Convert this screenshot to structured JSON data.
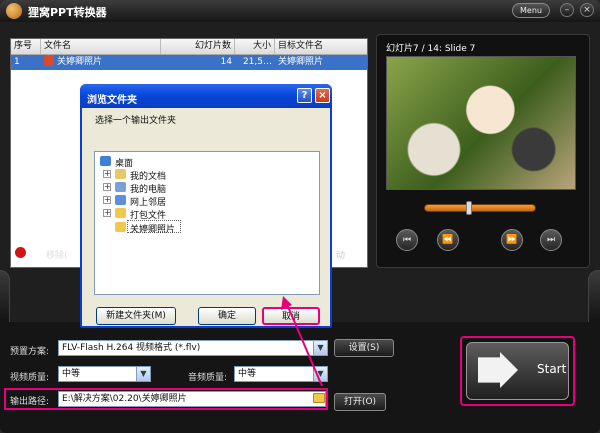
{
  "app": {
    "title": "狸窝PPT转换器",
    "menu_label": "Menu",
    "minimize": "–",
    "close": "×"
  },
  "file_table": {
    "headers": [
      "序号",
      "文件名",
      "幻灯片数",
      "大小",
      "目标文件名"
    ],
    "rows": [
      {
        "index": "1",
        "name": "关婷卿照片",
        "slides": "14",
        "size": "21,5…",
        "target": "关婷卿照片"
      }
    ],
    "remove_label": "移除(",
    "hidden_fragment": "动"
  },
  "preview": {
    "slide_label": "幻灯片7 / 14: Slide 7",
    "progress_fraction": 0.4,
    "controls": [
      "⏮",
      "⏪",
      "⏩",
      "⏭"
    ]
  },
  "dialog": {
    "title": "浏览文件夹",
    "help": "?",
    "close": "×",
    "prompt": "选择一个输出文件夹",
    "tree": [
      {
        "label": "桌面",
        "icon": "desktop-icon",
        "color": "#3f7fd6"
      },
      {
        "label": "我的文档",
        "icon": "documents-folder-icon",
        "color": "#e8c766"
      },
      {
        "label": "我的电脑",
        "icon": "computer-icon",
        "color": "#7aa0d6"
      },
      {
        "label": "网上邻居",
        "icon": "network-icon",
        "color": "#5b8fd8"
      },
      {
        "label": "打包文件",
        "icon": "folder-icon",
        "color": "#f2c84b"
      },
      {
        "label": "关婷卿照片",
        "icon": "open-folder-icon",
        "color": "#f2c84b"
      }
    ],
    "new_folder_button": "新建文件夹(M)",
    "ok_button": "确定",
    "cancel_button": "取消"
  },
  "settings": {
    "preset_label": "预置方案:",
    "preset_value": "FLV-Flash H.264 视频格式 (*.flv)",
    "settings_button": "设置(S)",
    "video_quality_label": "视频质量:",
    "video_quality_value": "中等",
    "audio_quality_label": "音频质量:",
    "audio_quality_value": "中等",
    "output_path_label": "输出路径:",
    "output_path_value": "E:\\解决方案\\02.20\\关婷卿照片",
    "open_button": "打开(O)",
    "start_label": "Start"
  },
  "colors": {
    "accent_pink": "#e6007e",
    "selection_blue": "#3a72c8",
    "dialog_blue": "#0546d8"
  }
}
